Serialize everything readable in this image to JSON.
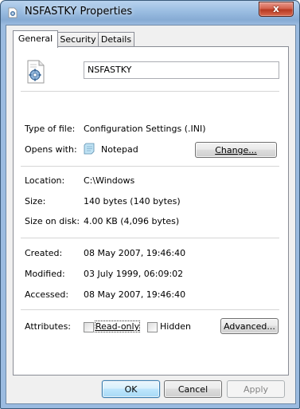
{
  "window": {
    "title": "NSFASTKY Properties",
    "close_glyph": "x"
  },
  "tabs": [
    {
      "label": "General",
      "active": true
    },
    {
      "label": "Security",
      "active": false
    },
    {
      "label": "Details",
      "active": false
    }
  ],
  "general": {
    "file_name": "NSFASTKY",
    "type_label": "Type of file:",
    "type_value": "Configuration Settings (.INI)",
    "opens_label": "Opens with:",
    "opens_value": "Notepad",
    "change_button": "Change...",
    "location_label": "Location:",
    "location_value": "C:\\Windows",
    "size_label": "Size:",
    "size_value": "140 bytes (140 bytes)",
    "size_on_disk_label": "Size on disk:",
    "size_on_disk_value": "4.00 KB (4,096 bytes)",
    "created_label": "Created:",
    "created_value": "08 May 2007, 19:46:40",
    "modified_label": "Modified:",
    "modified_value": "03 July 1999, 06:09:02",
    "accessed_label": "Accessed:",
    "accessed_value": "08 May 2007, 19:46:40",
    "attributes_label": "Attributes:",
    "readonly_label": "Read-only",
    "readonly_checked": false,
    "hidden_label": "Hidden",
    "hidden_checked": false,
    "advanced_button": "Advanced..."
  },
  "footer": {
    "ok_button": "OK",
    "cancel_button": "Cancel",
    "apply_button": "Apply"
  },
  "icons": {
    "title_icon": "ini-settings-file-icon",
    "file_icon": "ini-settings-file-icon",
    "opens_icon": "notepad-icon"
  },
  "colors": {
    "title_bar": "#9dbfe3",
    "close_button": "#d4624e",
    "primary_button_border": "#3c7fb1"
  }
}
